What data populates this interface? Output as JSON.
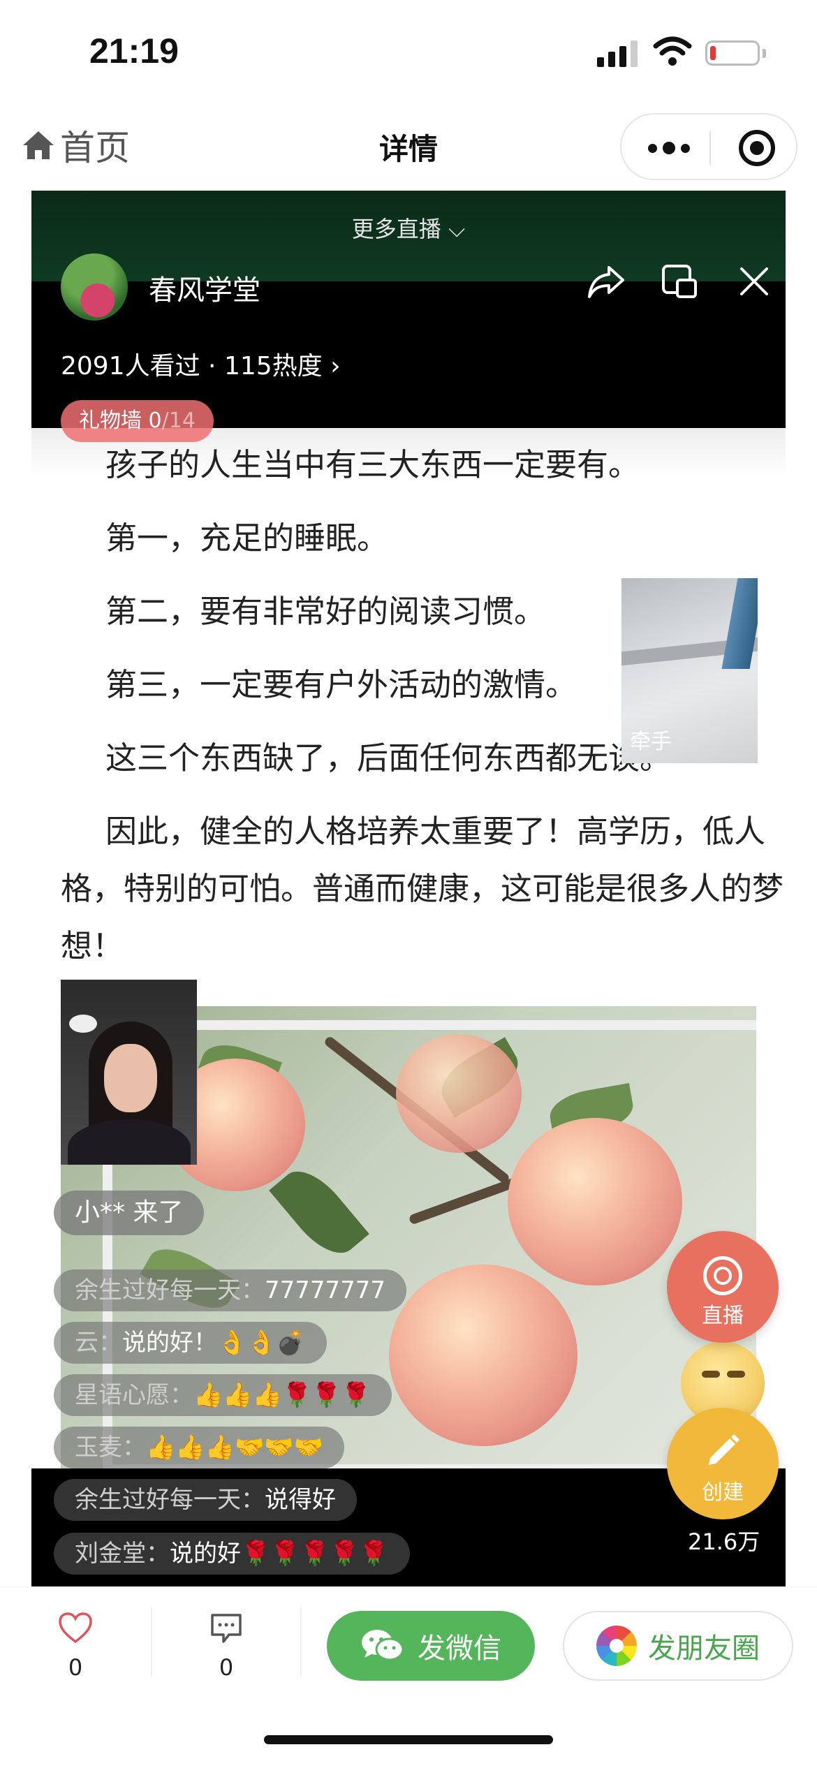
{
  "status_bar": {
    "time": "21:19"
  },
  "nav": {
    "home_label": "首页",
    "title": "详情"
  },
  "live": {
    "more_live_label": "更多直播 ⌵",
    "host_name": "春风学堂",
    "stats": "2091人看过 · 115热度 ›",
    "gift_wall": {
      "label": "礼物墙 0",
      "count": "/14"
    },
    "slide_lines": [
      "孩子的人生当中有三大东西一定要有。",
      "第一，充足的睡眠。",
      "第二，要有非常好的阅读习惯。",
      "第三，一定要有户外活动的激情。",
      "这三个东西缺了，后面任何东西都无谈。"
    ],
    "slide_paragraph": "因此，健全的人格培养太重要了！高学历，低人格，特别的可怕。普通而健康，这可能是很多人的梦想！",
    "guest_label": "牵手",
    "join_notice": "小** 来了",
    "comments": [
      {
        "user": "余生过好每一天：",
        "text": "77777777"
      },
      {
        "user": "云：",
        "text": "说的好！👌👌💣"
      },
      {
        "user": "星语心愿：",
        "text": "👍👍👍🌹🌹🌹"
      },
      {
        "user": "玉麦：",
        "text": "👍👍👍🤝🤝🤝"
      },
      {
        "user": "余生过好每一天：",
        "text": "说得好"
      },
      {
        "user": "刘金堂：",
        "text": "说的好🌹🌹🌹🌹🌹"
      }
    ],
    "fab_live_label": "直播",
    "fab_create_label": "创建",
    "view_count": "21.6万"
  },
  "bottom_bar": {
    "like_count": "0",
    "comment_count": "0",
    "wechat_label": "发微信",
    "moments_label": "发朋友圈"
  },
  "colors": {
    "wechat_green": "#55b55a",
    "live_fab": "#e8705e",
    "create_fab": "#f2b83a",
    "gift_wall": "#ee6e6e"
  },
  "icons": [
    "home-icon",
    "more-dots-icon",
    "record-icon",
    "share-icon",
    "pip-icon",
    "close-icon",
    "heart-icon",
    "comment-icon",
    "wechat-icon",
    "moments-icon"
  ]
}
